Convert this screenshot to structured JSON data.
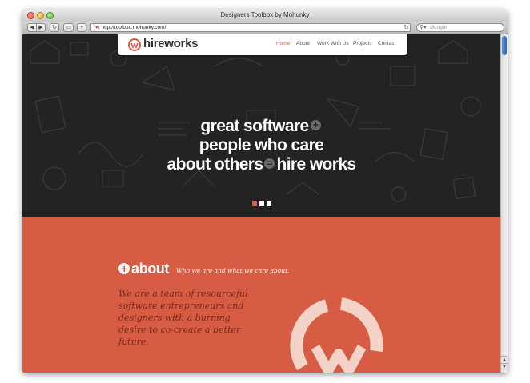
{
  "window": {
    "title": "Designers Toolbox by Mohunky"
  },
  "toolbar": {
    "back_icon": "back-arrow",
    "forward_icon": "forward-arrow",
    "reload_icon": "reload",
    "add_bookmark": "+",
    "url": "http://toolbox.mohunky.com/",
    "search_placeholder": "Google"
  },
  "site": {
    "logo_text": "hireworks",
    "nav": [
      "Home",
      "About",
      "Work With Us",
      "Projects",
      "Contact"
    ],
    "active_nav": "Home",
    "brand_color": "#d65c44"
  },
  "hero": {
    "line1": "great software",
    "line2": "people who care",
    "line3a": "about others",
    "line3b": "hire works",
    "op_plus": "+",
    "op_equals": "=",
    "slide_count": 3,
    "active_slide": 1
  },
  "about": {
    "title": "about",
    "badge": "+",
    "subtitle": "Who we are and what we care about.",
    "paragraph": "We are a team of resourceful software entrepreneurs and designers with a burning desire to co-create a better future."
  }
}
